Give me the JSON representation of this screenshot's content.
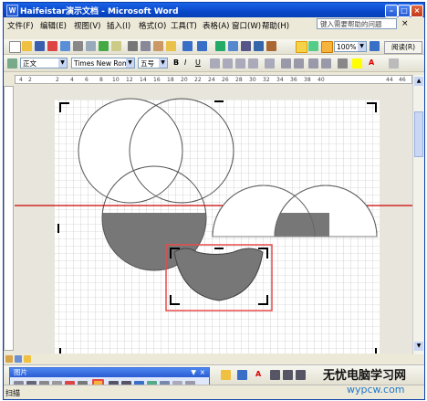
{
  "window": {
    "title": "Haifeistar演示文档 - Microsoft Word"
  },
  "menu": {
    "items": [
      "文件(F)",
      "编辑(E)",
      "视图(V)",
      "插入(I)",
      "格式(O)",
      "工具(T)",
      "表格(A)",
      "窗口(W)",
      "帮助(H)"
    ],
    "help_placeholder": "键入需要帮助的问题"
  },
  "toolbar": {
    "zoom": "100%",
    "read_label": "阅读(R)"
  },
  "format_toolbar": {
    "style": "正文",
    "font": "Times New Roman",
    "size": "五号"
  },
  "ruler": {
    "h_ticks": [
      "4",
      "2",
      "2",
      "4",
      "6",
      "8",
      "10",
      "12",
      "14",
      "16",
      "18",
      "20",
      "22",
      "24",
      "26",
      "28",
      "30",
      "32",
      "34",
      "36",
      "38",
      "40",
      "44",
      "46"
    ]
  },
  "picture_toolbar": {
    "title": "图片"
  },
  "statusbar": {
    "text": "扫描"
  },
  "watermark": {
    "line1": "无忧电脑学习网",
    "line2": "wypcw.com"
  },
  "colors": {
    "fill_gray": "#777777",
    "red_highlight": "#e84a4a",
    "guide_line": "#cc0000"
  }
}
